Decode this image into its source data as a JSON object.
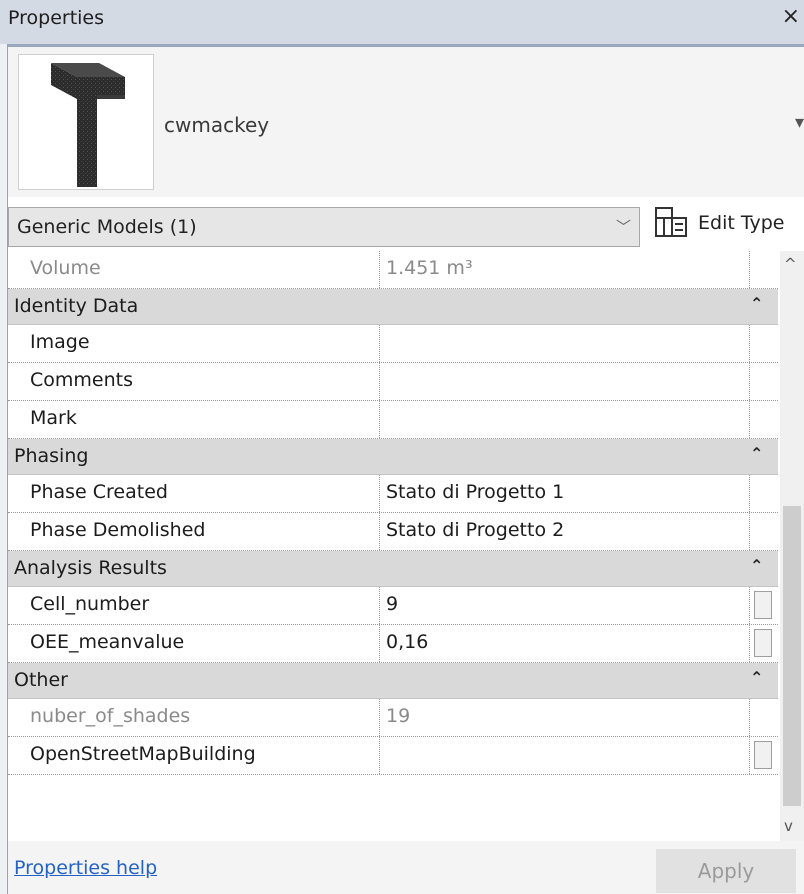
{
  "window": {
    "title": "Properties",
    "close_glyph": "×"
  },
  "type_selector": {
    "name": "cwmackey",
    "thumbnail_icon": "l-shaped-shade-3d-icon",
    "dropdown_icon": "chevron-down-icon"
  },
  "filter": {
    "selected": "Generic Models (1)",
    "dropdown_icon": "chevron-down-icon"
  },
  "edit_type": {
    "label": "Edit Type",
    "icon": "edit-type-icon"
  },
  "rows": {
    "volume": {
      "label": "Volume",
      "value": "1.451 m³"
    },
    "image": {
      "label": "Image",
      "value": ""
    },
    "comments": {
      "label": "Comments",
      "value": ""
    },
    "mark": {
      "label": "Mark",
      "value": ""
    },
    "phase_created": {
      "label": "Phase Created",
      "value": "Stato di Progetto 1"
    },
    "phase_demolished": {
      "label": "Phase Demolished",
      "value": "Stato di Progetto 2"
    },
    "cell_number": {
      "label": "Cell_number",
      "value": "9"
    },
    "oee_meanvalue": {
      "label": "OEE_meanvalue",
      "value": "0,16"
    },
    "nuber_of_shades": {
      "label": "nuber_of_shades",
      "value": "19"
    },
    "openstreetmap": {
      "label": "OpenStreetMapBuilding",
      "value": ""
    }
  },
  "groups": {
    "identity": {
      "label": "Identity Data",
      "collapse_glyph": "⌃"
    },
    "phasing": {
      "label": "Phasing",
      "collapse_glyph": "⌃"
    },
    "analysis": {
      "label": "Analysis Results",
      "collapse_glyph": "⌃"
    },
    "other": {
      "label": "Other",
      "collapse_glyph": "⌃"
    }
  },
  "scroll": {
    "up_glyph": "^",
    "down_glyph": "v"
  },
  "footer": {
    "help_link": "Properties help",
    "apply_label": "Apply"
  },
  "colors": {
    "titlebar": "#d3dae3",
    "group_header": "#d9d9d9",
    "link": "#2462c4",
    "apply_disabled_text": "#9a9a9a"
  }
}
